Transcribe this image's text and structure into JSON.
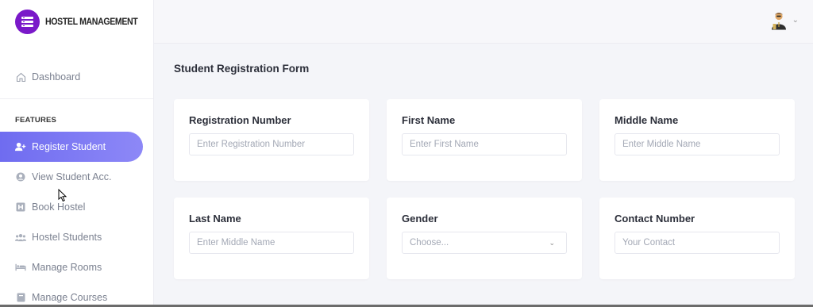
{
  "brand": {
    "name": "HOSTEL MANAGEMENT"
  },
  "sidebar": {
    "dashboard": "Dashboard",
    "section_label": "FEATURES",
    "items": [
      {
        "label": "Register Student",
        "icon": "user-plus-icon",
        "active": true
      },
      {
        "label": "View Student Acc.",
        "icon": "user-circle-icon",
        "active": false
      },
      {
        "label": "Book Hostel",
        "icon": "hostel-icon",
        "active": false
      },
      {
        "label": "Hostel Students",
        "icon": "users-icon",
        "active": false
      },
      {
        "label": "Manage Rooms",
        "icon": "bed-icon",
        "active": false
      },
      {
        "label": "Manage Courses",
        "icon": "book-icon",
        "active": false
      }
    ]
  },
  "page": {
    "title": "Student Registration Form"
  },
  "form": {
    "registration_number": {
      "label": "Registration Number",
      "placeholder": "Enter Registration Number"
    },
    "first_name": {
      "label": "First Name",
      "placeholder": "Enter First Name"
    },
    "middle_name": {
      "label": "Middle Name",
      "placeholder": "Enter Middle Name"
    },
    "last_name": {
      "label": "Last Name",
      "placeholder": "Enter Middle Name"
    },
    "gender": {
      "label": "Gender",
      "selected": "Choose..."
    },
    "contact_number": {
      "label": "Contact Number",
      "placeholder": "Your Contact"
    }
  },
  "colors": {
    "brand": "#7a19c9",
    "active_nav": "#7b78f3",
    "background": "#f4f5f9"
  }
}
